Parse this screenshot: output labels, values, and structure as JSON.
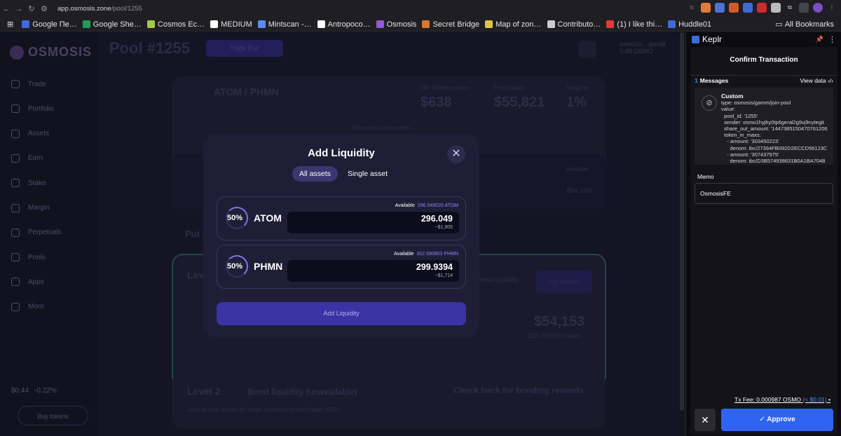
{
  "browser": {
    "url_host": "app.osmosis.zone",
    "url_path": "/pool/1255",
    "bookmarks": [
      {
        "label": "Google Пе…",
        "color": "#3f6ad8"
      },
      {
        "label": "Google She…",
        "color": "#1f9d55"
      },
      {
        "label": "Cosmos Ec…",
        "color": "#a6c94a"
      },
      {
        "label": "MEDIUM",
        "color": "#ffffff"
      },
      {
        "label": "Mintscan -…",
        "color": "#5b8ded"
      },
      {
        "label": "Antropoco…",
        "color": "#ffffff"
      },
      {
        "label": "Osmosis",
        "color": "#8e5bd6"
      },
      {
        "label": "Secret Bridge",
        "color": "#d9782e"
      },
      {
        "label": "Map of zon…",
        "color": "#e0c24a"
      },
      {
        "label": "Contributo…",
        "color": "#cccccc"
      },
      {
        "label": "(1) I like thi…",
        "color": "#e53935"
      },
      {
        "label": "Huddle01",
        "color": "#3f6ad8"
      }
    ],
    "all_bookmarks": "All Bookmarks"
  },
  "sidebar": {
    "brand": "OSMOSIS",
    "items": [
      "Trade",
      "Portfolio",
      "Assets",
      "Earn",
      "Stake",
      "Margin",
      "Perpetuals",
      "Pools",
      "Apps",
      "More"
    ],
    "price": "$0.44",
    "change": "-0.22%",
    "buy_label": "Buy tokens"
  },
  "header": {
    "title": "Pool #1255",
    "trade_pair": "Trade Pair",
    "wallet_name": "osmo1h…qwre8",
    "wallet_balance": "0.49 OSMO"
  },
  "pool": {
    "pair": "ATOM / PHMN",
    "volume_label": "24h Trading volume",
    "volume": "$638",
    "liquidity_label": "Pool liquidity",
    "liquidity": "$55,821",
    "fee_label": "Swap fee",
    "fee": "1%",
    "show_composition": "Show pool composition ⌄",
    "available_label": "Available",
    "available_value": "$54,153",
    "put_label": "Put y",
    "level_label": "Leve",
    "remove_liquidity": "move Liquidity",
    "add_liquidity_bg": "Add liquidity",
    "balance_usd": "$54,153",
    "balance_shares": "222.328953 shares",
    "level2": "Level 2",
    "bond_title": "Bond liquidity (unavailable)",
    "bond_desc": "Lock up your shares for longer durations to earn higher APRs.",
    "bond_note": "Check back for bonding rewards"
  },
  "modal": {
    "title": "Add Liquidity",
    "tabs": [
      "All assets",
      "Single asset"
    ],
    "assets": [
      {
        "pct": "50%",
        "symbol": "ATOM",
        "available_label": "Available",
        "available": "296.049020 ATOM",
        "amount": "296.049",
        "usd": "~$1,905"
      },
      {
        "pct": "50%",
        "symbol": "PHMN",
        "available_label": "Available",
        "available": "302.690803 PHMN",
        "amount": "299.9394",
        "usd": "~$1,714"
      }
    ],
    "submit": "Add Liquidity"
  },
  "keplr": {
    "title": "Keplr",
    "confirm": "Confirm Transaction",
    "messages_count": "1",
    "messages_label": "Messages",
    "view_data": "View data ‹/›",
    "msg_title": "Custom",
    "msg_body": "type: osmosis/gamm/join-pool\nvalue:\n  pool_id: '1255'\n  sender: osmo1hyjhy0tp6geral2g9vj9nytegit\n  share_out_amount: '1447385150470761206\n  token_in_maxs:\n    - amount: '303450223'\n      denom: ibc/27394FB092D2ECCD56123C\n    - amount: '307437975'\n      denom: ibc/D3B574938631B0A1BA7048",
    "memo_label": "Memo",
    "memo_value": "OsmosisFE",
    "fee_text": "Tx Fee: 0.000987 OSMO",
    "fee_usd": "(< $0.01)",
    "approve": "✓ Approve",
    "reject": "✕"
  }
}
